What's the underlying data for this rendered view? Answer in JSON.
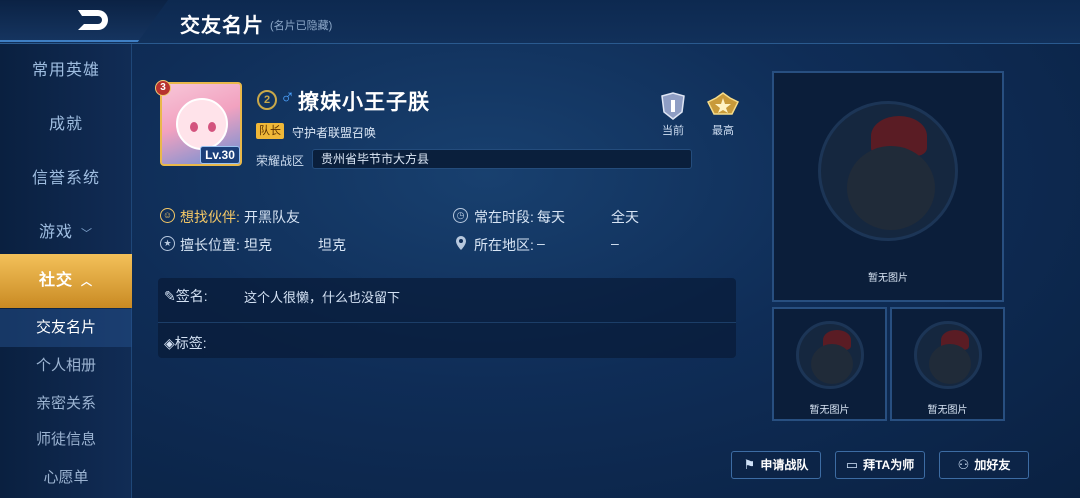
{
  "header": {
    "title": "交友名片",
    "subtitle": "(名片已隐藏)"
  },
  "sidebar": {
    "items": [
      {
        "label": "常用英雄"
      },
      {
        "label": "成就"
      },
      {
        "label": "信誉系统"
      },
      {
        "label": "游戏",
        "chevron": "﹀"
      },
      {
        "label": "社交",
        "chevron": "︿",
        "active": true
      }
    ],
    "subitems": [
      {
        "label": "交友名片",
        "active": true
      },
      {
        "label": "个人相册"
      },
      {
        "label": "亲密关系"
      },
      {
        "label": "师徒信息"
      },
      {
        "label": "心愿单"
      }
    ]
  },
  "profile": {
    "rank_level": "3",
    "level_badge": "Lv.30",
    "medal_level": "2",
    "gender_icon": "♂",
    "name": "撩妹小王子朕",
    "captain_tag": "队长",
    "guild": "守护者联盟召唤",
    "zone_label": "荣耀战区",
    "zone_value": "贵州省毕节市大方县",
    "rank_current_label": "当前",
    "rank_best_label": "最高"
  },
  "info": {
    "partner_label": "想找伙伴:",
    "partner_value": "开黑队友",
    "time_label": "常在时段:",
    "time_value": "每天",
    "time_value2": "全天",
    "position_label": "擅长位置:",
    "position_value": "坦克",
    "position_value2": "坦克",
    "region_label": "所在地区:",
    "region_value": "–",
    "region_value2": "–"
  },
  "signature": {
    "sig_label": "签名:",
    "sig_value": "这个人很懒，什么也没留下",
    "tag_label": "标签:"
  },
  "photos": {
    "no_photo": "暂无图片"
  },
  "actions": {
    "apply_team": "申请战队",
    "apprentice": "拜TA为师",
    "add_friend": "加好友"
  },
  "colors": {
    "accent_gold": "#f3c15a",
    "background": "#0f2d57",
    "male_blue": "#4da3ff"
  },
  "icons": [
    "back-icon",
    "chevron-down-icon",
    "chevron-up-icon",
    "medal-icon",
    "male-icon",
    "rank-current-icon",
    "rank-best-icon",
    "partner-icon",
    "clock-icon",
    "star-icon",
    "location-icon",
    "pen-icon",
    "tag-icon",
    "team-icon",
    "book-icon",
    "add-friend-icon"
  ]
}
